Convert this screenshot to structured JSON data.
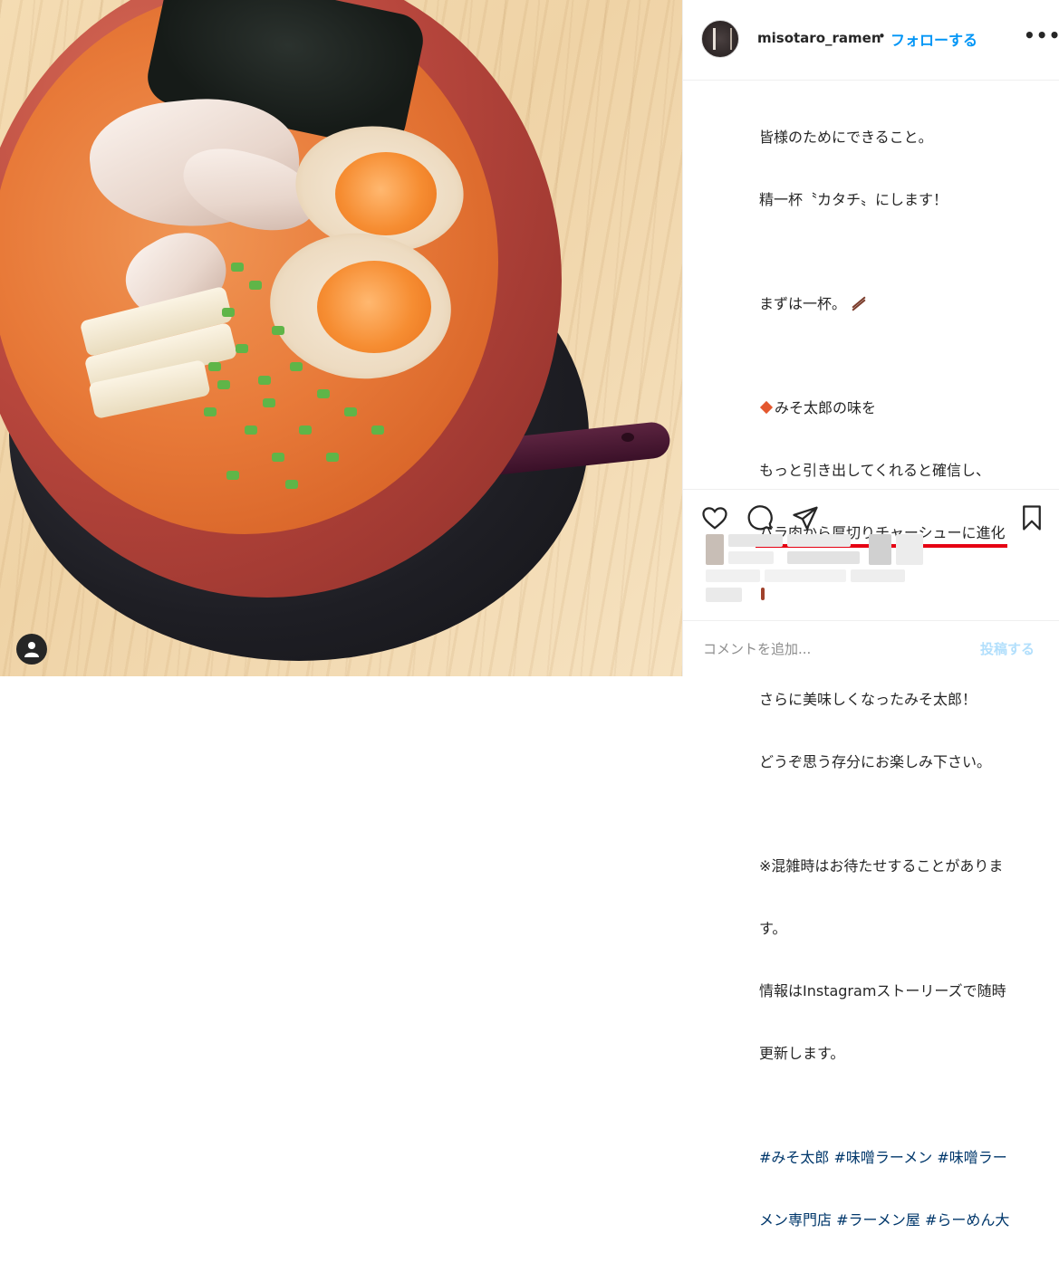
{
  "post": {
    "photo_alt": "",
    "profile_button_icon": "user-icon"
  },
  "header": {
    "username": "misotaro_ramen",
    "separator": "•",
    "follow_label": "フォローする",
    "more_icon": "more-icon",
    "more_label": "•••"
  },
  "caption": {
    "lines": [
      "皆様のためにできること。",
      "精一杯〝カタチ〟にします！",
      "",
      "まずは一杯。",
      "",
      "みそ太郎の味を",
      "もっと引き出してくれると確信し、",
      "バラ肉から厚切りチャーシューに進化",
      "",
      "",
      "さらに美味しくなったみそ太郎！",
      "どうぞ思う存分にお楽しみ下さい。",
      "",
      "※混雑時はお待たせすることがありま",
      "す。",
      "情報はInstagramストーリーズで随時",
      "更新します。",
      ""
    ],
    "hashtags_line1": "#みそ太郎 #味噌ラーメン #味噌ラー",
    "hashtags_line2": "メン専門店 #ラーメン屋 #らーめん大",
    "highlight_color": "#e60012"
  },
  "actions": {
    "like_icon": "heart-icon",
    "comment_icon": "comment-icon",
    "share_icon": "share-icon",
    "save_icon": "bookmark-icon"
  },
  "comment": {
    "placeholder": "コメントを追加...",
    "post_label": "投稿する"
  },
  "colors": {
    "accent": "#0095f6",
    "post_disabled": "#b2dffc",
    "text": "#262626",
    "hashtag": "#00376b"
  }
}
